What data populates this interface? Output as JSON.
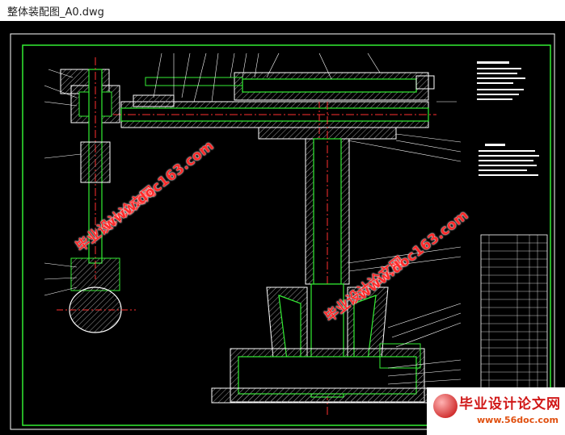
{
  "window": {
    "title": "整体装配图_A0.dwg"
  },
  "watermarks": [
    {
      "text": "毕业设计论文网"
    },
    {
      "text": "www.doc163.com"
    },
    {
      "text": "毕业设计论文网"
    },
    {
      "text": "www.doc163.com"
    }
  ],
  "logo": {
    "text": "毕业设计论文网",
    "url": "www.56doc.com"
  },
  "colors": {
    "background": "#000000",
    "line_green": "#33ee33",
    "outline_white": "#ffffff",
    "centerline_red": "#ff3030",
    "hatch": "#9a9a9a"
  }
}
